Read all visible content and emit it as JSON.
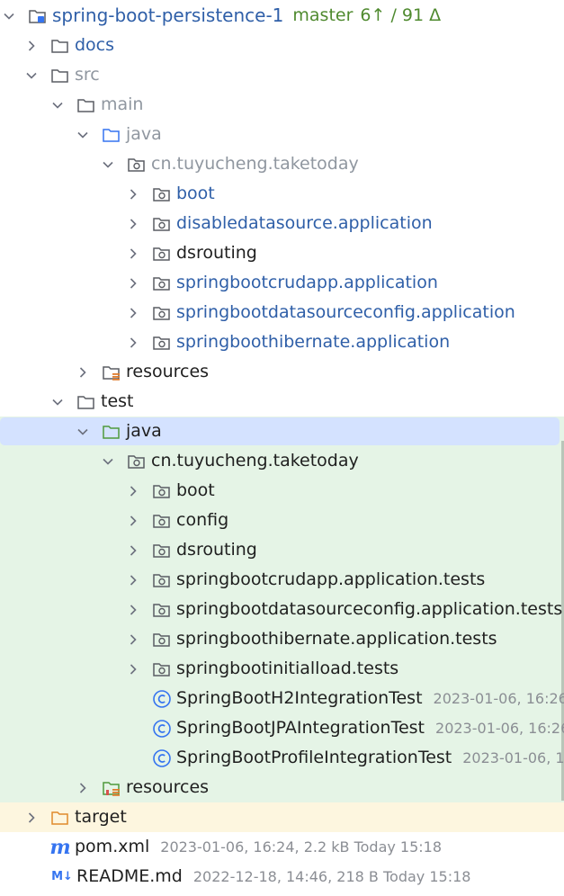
{
  "project": {
    "name": "spring-boot-persistence-1",
    "branch": "master",
    "status": "6↑ / 91 Δ"
  },
  "tree": {
    "docs": "docs",
    "src": "src",
    "main": "main",
    "main_java": "java",
    "main_package": "cn.tuyucheng.taketoday",
    "main_packages": [
      "boot",
      "disabledatasource.application",
      "dsrouting",
      "springbootcrudapp.application",
      "springbootdatasourceconfig.application",
      "springboothibernate.application"
    ],
    "main_resources": "resources",
    "test": "test",
    "test_java": "java",
    "test_package": "cn.tuyucheng.taketoday",
    "test_packages": [
      "boot",
      "config",
      "dsrouting",
      "springbootcrudapp.application.tests",
      "springbootdatasourceconfig.application.tests",
      "springboothibernate.application.tests",
      "springbootinitialload.tests"
    ],
    "test_classes": [
      {
        "name": "SpringBootH2IntegrationTest",
        "meta": "2023-01-06, 16:26,"
      },
      {
        "name": "SpringBootJPAIntegrationTest",
        "meta": "2023-01-06, 16:26"
      },
      {
        "name": "SpringBootProfileIntegrationTest",
        "meta": "2023-01-06, 16"
      }
    ],
    "test_resources": "resources",
    "target": "target",
    "files": [
      {
        "name": "pom.xml",
        "meta": "2023-01-06, 16:24, 2.2 kB Today 15:18",
        "icon_glyph": "m"
      },
      {
        "name": "README.md",
        "meta": "2022-12-18, 14:46, 218 B Today 15:18",
        "icon_glyph": "M↓"
      }
    ]
  },
  "colors": {
    "test_background": "#e5f4e6",
    "target_background": "#fdf6df",
    "selection": "#d4e2ff",
    "modified_blue": "#2f5fa8",
    "git_green": "#4f8a2f"
  },
  "icons": {
    "chevron_collapsed": "chevron-right-icon",
    "chevron_expanded": "chevron-down-icon",
    "folder": "folder-icon",
    "package": "package-icon",
    "class": "class-icon"
  }
}
